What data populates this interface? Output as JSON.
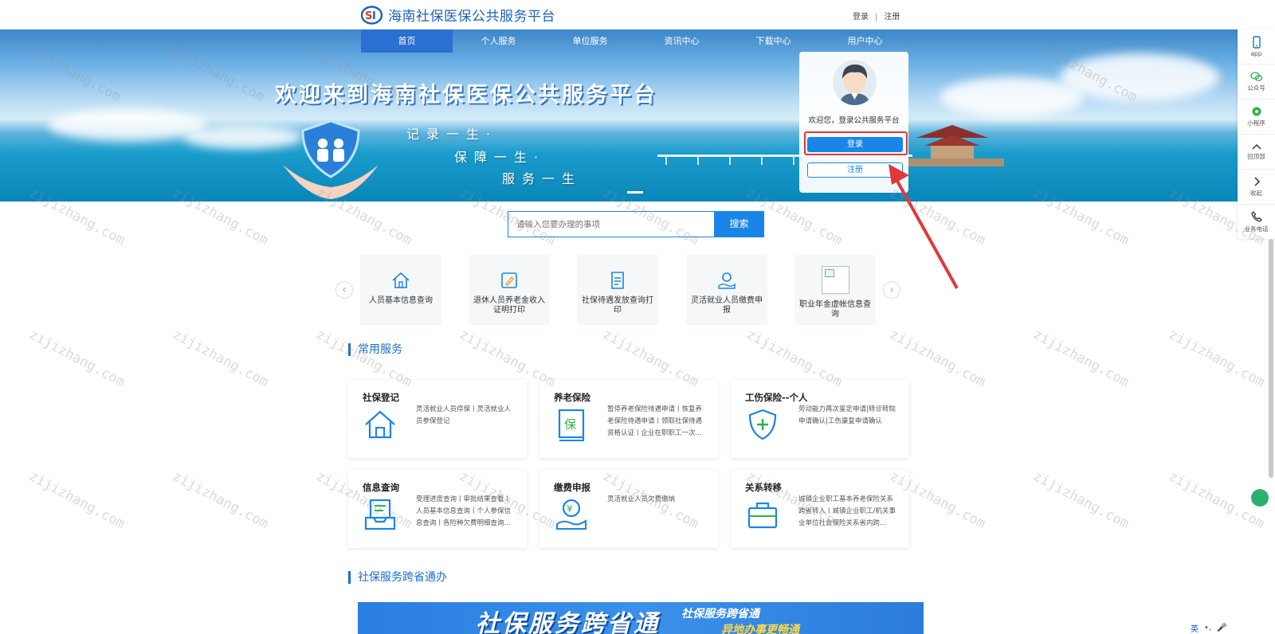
{
  "header": {
    "site_title": "海南社保医保公共服务平台",
    "login_link": "登录",
    "separator": "|",
    "register_link": "注册"
  },
  "nav": {
    "items": [
      {
        "label": "首页",
        "active": true
      },
      {
        "label": "个人服务",
        "active": false
      },
      {
        "label": "单位服务",
        "active": false
      },
      {
        "label": "资讯中心",
        "active": false
      },
      {
        "label": "下载中心",
        "active": false
      },
      {
        "label": "用户中心",
        "active": false
      }
    ]
  },
  "banner": {
    "title": "欢迎来到海南社保医保公共服务平台",
    "slogans": [
      "记录一生·",
      "保障一生·",
      "服务一生"
    ]
  },
  "login_card": {
    "welcome": "欢迎您，登录公共服务平台",
    "login_button": "登录",
    "register_button": "注册"
  },
  "toolbar": {
    "items": [
      {
        "label": "app",
        "icon": "phone-icon"
      },
      {
        "label": "公众号",
        "icon": "wechat-icon"
      },
      {
        "label": "小程序",
        "icon": "miniprogram-icon"
      },
      {
        "label": "回顶部",
        "icon": "chevron-up-icon"
      },
      {
        "label": "收起",
        "icon": "chevron-right-icon"
      },
      {
        "label": "业务电话",
        "icon": "phone-call-icon"
      }
    ]
  },
  "search": {
    "placeholder": "请输入您要办理的事项",
    "button": "搜索"
  },
  "quick_services": [
    {
      "label": "人员基本信息查询",
      "icon": "home-icon"
    },
    {
      "label": "退休人员养老金收入证明打印",
      "icon": "certificate-icon"
    },
    {
      "label": "社保待遇发放查询打印",
      "icon": "document-print-icon"
    },
    {
      "label": "灵活就业人员缴费申报",
      "icon": "payment-icon"
    },
    {
      "label": "职业年金虚帐信息查询",
      "icon": "broken-image-icon"
    }
  ],
  "sections": {
    "common_services": "常用服务",
    "cross_province": "社保服务跨省通办"
  },
  "service_cards": [
    {
      "title": "社保登记",
      "desc": "灵活就业人员停保丨灵活就业人员参保登记",
      "icon": "house-icon"
    },
    {
      "title": "养老保险",
      "desc": "暂停养老保险待遇申请丨恢复养老保险待遇申请丨领取社保待遇资格认证丨企业在职职工一次...",
      "icon": "pension-book-icon"
    },
    {
      "title": "工伤保险--个人",
      "desc": "劳动能力再次鉴定申请|转诊转院申请确认|工伤康复申请确认",
      "icon": "shield-plus-icon"
    },
    {
      "title": "信息查询",
      "desc": "受理进度查询丨审批结果查看丨人员基本信息查询丨个人参保信息查询丨各险种欠费明细查询...",
      "icon": "inbox-list-icon"
    },
    {
      "title": "缴费申报",
      "desc": "灵活就业人员欠费缴纳",
      "icon": "yuan-hand-icon"
    },
    {
      "title": "关系转移",
      "desc": "城镇企业职工基本养老保险关系跨省转入丨城镇企业职工/机关事业单位社会保险关系省内跨...",
      "icon": "briefcase-icon"
    }
  ],
  "promo": {
    "big_text": "社保服务跨省通",
    "small_text_1": "社保服务跨省通",
    "small_text_2": "异地办事更畅通"
  },
  "watermark": "zijizhang.com",
  "ime": {
    "lang": "英",
    "punct": "•,",
    "mic": "🎤"
  },
  "colors": {
    "brand_blue": "#1a6fc9",
    "button_blue": "#1a85e8",
    "highlight_red": "#e0383b"
  }
}
